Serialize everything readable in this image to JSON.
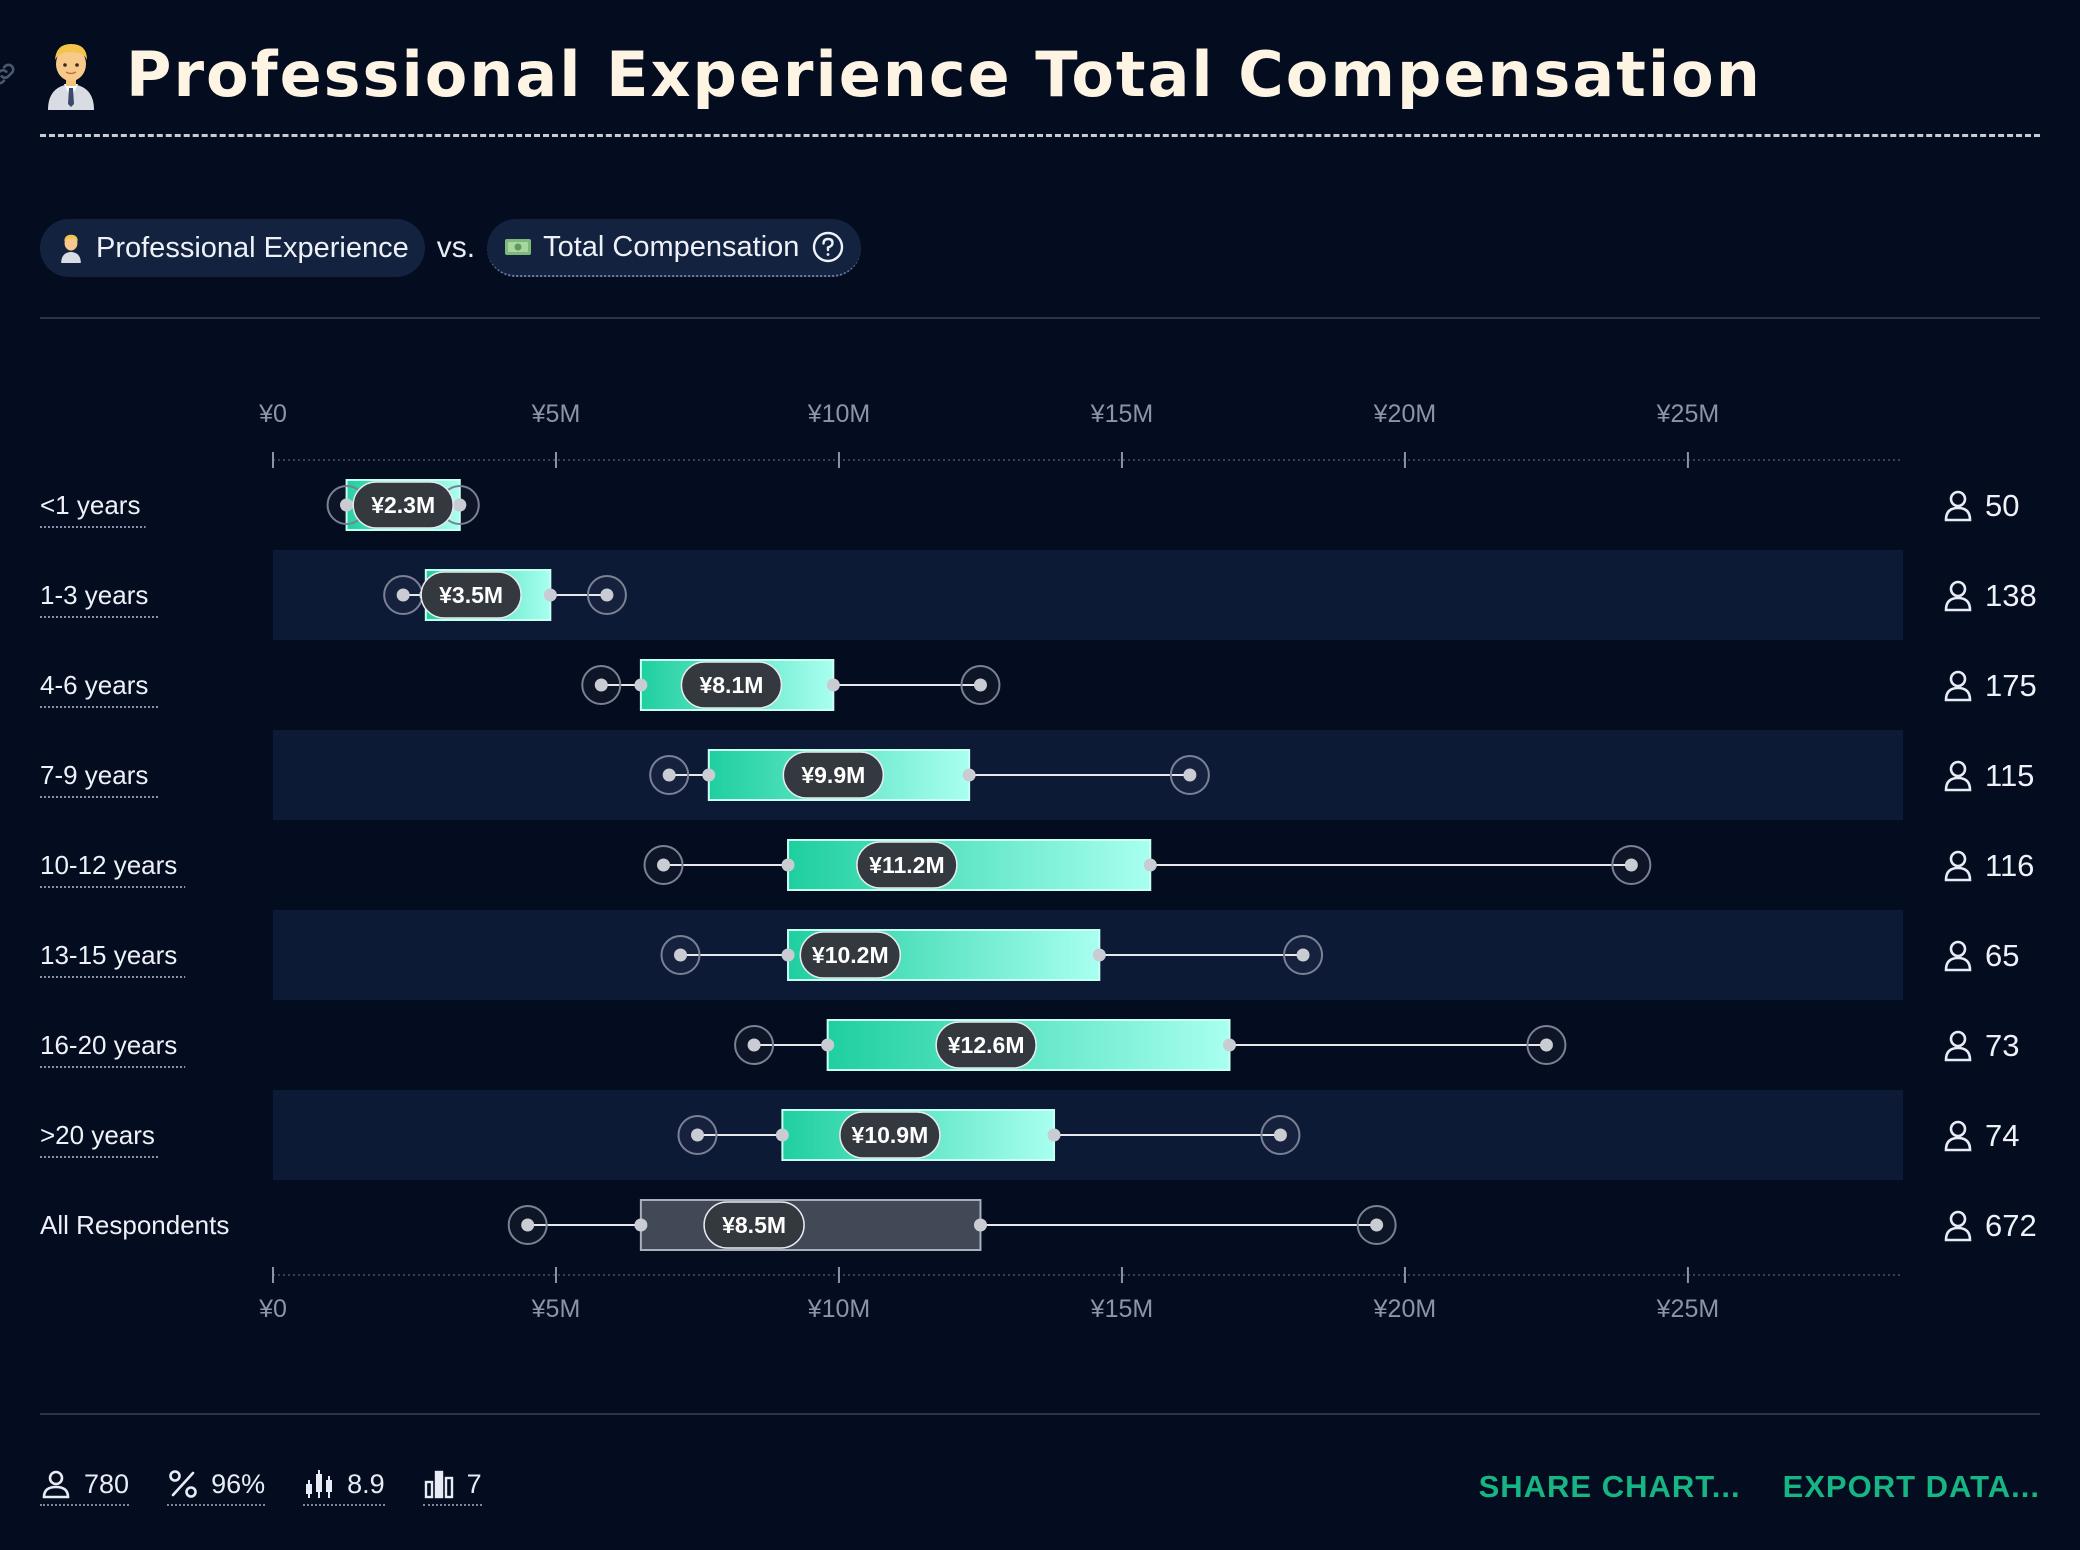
{
  "header": {
    "title": "Professional Experience Total Compensation"
  },
  "selectors": {
    "left_label": "Professional Experience",
    "vs_label": "vs.",
    "right_label": "Total Compensation"
  },
  "chart_data": {
    "type": "boxplot",
    "currency": "¥",
    "axis": {
      "min": 0,
      "max": 28.8,
      "ticks": [
        0,
        5,
        10,
        15,
        20,
        25
      ],
      "tick_labels": [
        "¥0",
        "¥5M",
        "¥10M",
        "¥15M",
        "¥20M",
        "¥25M"
      ]
    },
    "rows": [
      {
        "label": "<1 years",
        "min": 1.3,
        "q1": 1.3,
        "median": 2.3,
        "q3": 3.3,
        "max": 3.3,
        "median_label": "¥2.3M",
        "count": "50"
      },
      {
        "label": "1-3 years",
        "min": 2.3,
        "q1": 2.7,
        "median": 3.5,
        "q3": 4.9,
        "max": 5.9,
        "median_label": "¥3.5M",
        "count": "138"
      },
      {
        "label": "4-6 years",
        "min": 5.8,
        "q1": 6.5,
        "median": 8.1,
        "q3": 9.9,
        "max": 12.5,
        "median_label": "¥8.1M",
        "count": "175"
      },
      {
        "label": "7-9 years",
        "min": 7.0,
        "q1": 7.7,
        "median": 9.9,
        "q3": 12.3,
        "max": 16.2,
        "median_label": "¥9.9M",
        "count": "115"
      },
      {
        "label": "10-12 years",
        "min": 6.9,
        "q1": 9.1,
        "median": 11.2,
        "q3": 15.5,
        "max": 24.0,
        "median_label": "¥11.2M",
        "count": "116"
      },
      {
        "label": "13-15 years",
        "min": 7.2,
        "q1": 9.1,
        "median": 10.2,
        "q3": 14.6,
        "max": 18.2,
        "median_label": "¥10.2M",
        "count": "65"
      },
      {
        "label": "16-20 years",
        "min": 8.5,
        "q1": 9.8,
        "median": 12.6,
        "q3": 16.9,
        "max": 22.5,
        "median_label": "¥12.6M",
        "count": "73"
      },
      {
        "label": ">20 years",
        "min": 7.5,
        "q1": 9.0,
        "median": 10.9,
        "q3": 13.8,
        "max": 17.8,
        "median_label": "¥10.9M",
        "count": "74"
      },
      {
        "label": "All Respondents",
        "min": 4.5,
        "q1": 6.5,
        "median": 8.5,
        "q3": 12.5,
        "max": 19.5,
        "median_label": "¥8.5M",
        "count": "672",
        "aggregate": true
      }
    ]
  },
  "footer": {
    "stats": [
      {
        "icon": "person-icon",
        "value": "780"
      },
      {
        "icon": "percent-icon",
        "value": "96%"
      },
      {
        "icon": "candlestick-icon",
        "value": "8.9"
      },
      {
        "icon": "bar-chart-icon",
        "value": "7"
      }
    ],
    "share_label": "SHARE CHART...",
    "export_label": "EXPORT DATA..."
  },
  "colors": {
    "background": "#040c1f",
    "band": "#0d1a36",
    "box_start": "#1fcf9f",
    "box_end": "#a8fff0",
    "aggregate_box": "#414957",
    "accent": "#17b583"
  }
}
